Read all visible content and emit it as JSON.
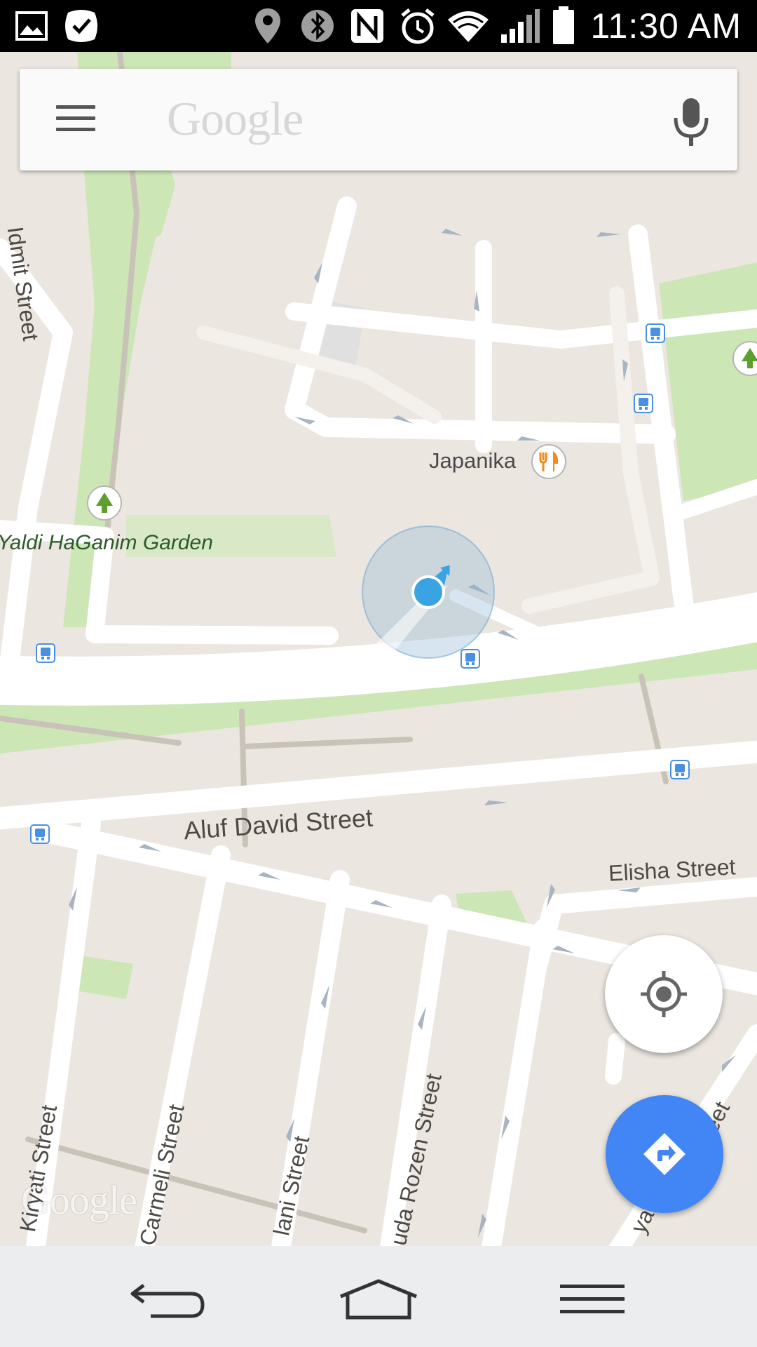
{
  "status_bar": {
    "time": "11:30 AM",
    "icons": [
      "image-icon",
      "check-badge-icon",
      "location-pin-icon",
      "bluetooth-icon",
      "nfc-icon",
      "alarm-icon",
      "wifi-icon",
      "signal-icon",
      "battery-icon"
    ]
  },
  "search": {
    "logo_text": "Google",
    "menu_icon": "hamburger-menu-icon",
    "mic_icon": "microphone-icon"
  },
  "map": {
    "streets": {
      "idmit": "Idmit Street",
      "aluf_david": "Aluf David Street",
      "elisha": "Elisha Street",
      "kiryati": "Kiryati Street",
      "carmeli": "Carmeli Street",
      "hani": "lani Street",
      "rozen": "uda Rozen Street",
      "eet": "eet",
      "yan": "yan"
    },
    "places": {
      "garden": "Yaldi HaGanim Garden",
      "restaurant": "Japanika"
    },
    "watermark": "Google",
    "colors": {
      "land": "#ebe6df",
      "park": "#cde6b6",
      "road": "#ffffff",
      "location_dot": "#3aa3e3",
      "fab_blue": "#4285f4",
      "restaurant_orange": "#f28b1b",
      "transit_blue": "#4a90e2"
    }
  },
  "controls": {
    "locate_icon": "my-location-icon",
    "directions_icon": "directions-icon"
  },
  "nav_bar": {
    "back_icon": "back-icon",
    "home_icon": "home-icon",
    "menu_icon": "menu-icon"
  }
}
